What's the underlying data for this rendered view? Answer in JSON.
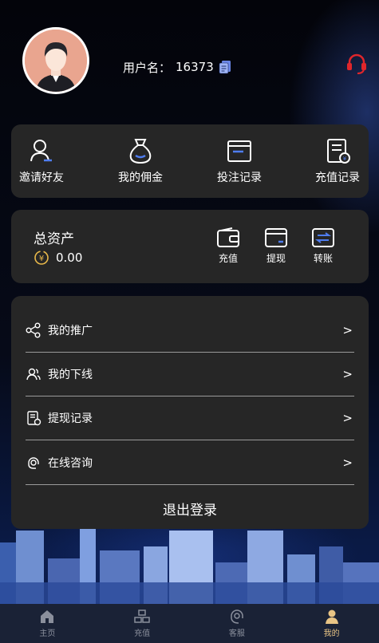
{
  "header": {
    "username_label": "用户名：",
    "username_value": "16373",
    "avatar_icon": "user-avatar",
    "copy_icon": "copy-icon",
    "service_icon": "headset-icon",
    "accent_color": "#e0262b"
  },
  "quick_actions": [
    {
      "label": "邀请好友",
      "icon": "invite-user-icon"
    },
    {
      "label": "我的佣金",
      "icon": "money-bag-icon"
    },
    {
      "label": "投注记录",
      "icon": "bet-record-icon"
    },
    {
      "label": "充值记录",
      "icon": "recharge-record-icon"
    }
  ],
  "assets": {
    "title": "总资产",
    "balance": "0.00",
    "currency_icon": "yen-coin-icon",
    "actions": [
      {
        "label": "充值",
        "icon": "wallet-icon"
      },
      {
        "label": "提现",
        "icon": "card-icon"
      },
      {
        "label": "转账",
        "icon": "transfer-icon"
      }
    ]
  },
  "menu": [
    {
      "label": "我的推广",
      "icon": "share-icon",
      "arrow": ">"
    },
    {
      "label": "我的下线",
      "icon": "team-icon",
      "arrow": ">"
    },
    {
      "label": "提现记录",
      "icon": "withdraw-record-icon",
      "arrow": ">"
    },
    {
      "label": "在线咨询",
      "icon": "consult-icon",
      "arrow": ">"
    }
  ],
  "logout_label": "退出登录",
  "tabbar": [
    {
      "label": "主页",
      "icon": "home-icon",
      "active": false
    },
    {
      "label": "充值",
      "icon": "recharge-icon",
      "active": false
    },
    {
      "label": "客服",
      "icon": "service-icon",
      "active": false
    },
    {
      "label": "我的",
      "icon": "profile-icon",
      "active": true
    }
  ]
}
